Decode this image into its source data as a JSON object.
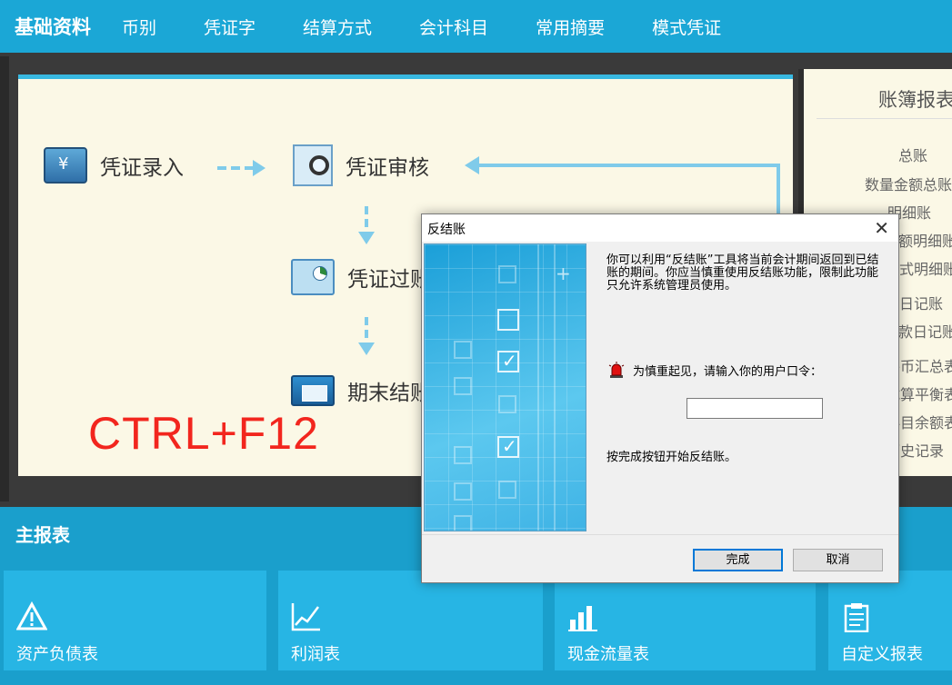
{
  "topnav": {
    "brand": "基础资料",
    "items": [
      "币别",
      "凭证字",
      "结算方式",
      "会计科目",
      "常用摘要",
      "模式凭证"
    ]
  },
  "flow": {
    "entry": "凭证录入",
    "audit": "凭证审核",
    "post": "凭证过账",
    "close": "期末结账"
  },
  "annotation": "CTRL+F12",
  "report_panel": {
    "title": "账簿报表",
    "items": [
      "总账",
      "数量金额总账",
      "明细账",
      "数量金额明细账",
      "多栏式明细账",
      "现金日记账",
      "银行存款日记账",
      "外币汇总表",
      "试算平衡表",
      "科目余额表",
      "历史记录"
    ]
  },
  "main_reports": {
    "title": "主报表",
    "tiles": [
      {
        "label": "资产负债表",
        "icon": "warning-triangle-icon"
      },
      {
        "label": "利润表",
        "icon": "line-chart-icon"
      },
      {
        "label": "现金流量表",
        "icon": "bar-chart-icon"
      },
      {
        "label": "自定义报表",
        "icon": "clipboard-icon"
      }
    ]
  },
  "dialog": {
    "title": "反结账",
    "message": "你可以利用“反结账”工具将当前会计期间返回到已结账的期间。你应当慎重使用反结账功能，限制此功能只允许系统管理员使用。",
    "prompt": "为慎重起见，请输入你的用户口令：",
    "password_value": "",
    "hint": "按完成按钮开始反结账。",
    "finish_label": "完成",
    "cancel_label": "取消"
  },
  "colors": {
    "nav_bg": "#1ba7d6",
    "panel_bg": "#fbf8e6",
    "accent": "#7fcbea",
    "annotation": "#f2261e"
  }
}
